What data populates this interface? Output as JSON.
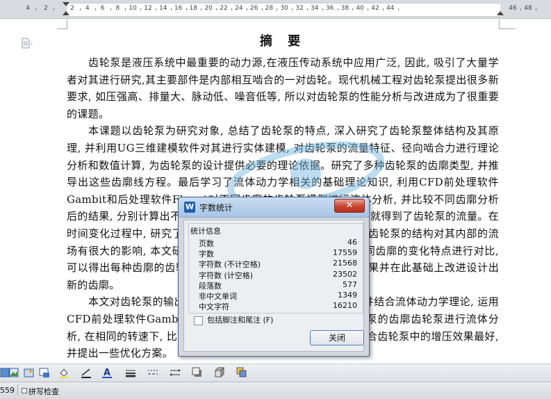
{
  "ruler": {
    "numbers": [
      "4",
      "2",
      "2",
      "4",
      "6",
      "8",
      "10",
      "12",
      "14",
      "16",
      "18",
      "20",
      "22",
      "24",
      "26",
      "28",
      "30",
      "32",
      "34",
      "36",
      "38",
      "40",
      "42",
      "44",
      "46",
      "48"
    ]
  },
  "document": {
    "title": "摘 要",
    "paragraphs": [
      "齿轮泵是液压系统中最重要的动力源,在液压传动系统中应用广泛, 因此, 吸引了大量学者对其进行研究,其主要部件是内部相互啮合的一对齿轮。现代机械工程对齿轮泵提出很多新要求, 如压强高、排量大、脉动低、噪音低等, 所以对齿轮泵的性能分析与改进成为了很重要的课题。",
      "本课题以齿轮泵为研究对象, 总结了齿轮泵的特点, 深入研究了齿轮泵整体结构及其原理, 并利用UG三维建模软件对其进行实体建模, 对齿轮泵的流量特征、径向啮合力进行理论分析和数值计算, 为齿轮泵的设计提供必要的理论依据。研究了多种齿轮泵的齿廓类型, 并推导出这些齿廓线方程。最后学习了流体动力学相关的基础理论知识, 利用CFD前处理软件Gambit和后处理软件Fluent对不同齿廓的齿轮泵模型进行流体分析, 并比较不同齿廓分析后的结果, 分别计算出不同齿廓的齿轮泵在出口区域的流量, 最后就得到了齿轮泵的流量。在时间变化过程中, 研究了其流场中压力与速度变化情况。外啮合齿轮泵的结构对其内部的流场有很大的影响, 本文研究了多种不同齿廓的齿轮泵模型, 就不同齿廓的变化特点进行对比, 可以得出每种齿廓的齿轮泵的流场分布情况, 选出最优的分析结果并在此基础上改进设计出新的齿廓。",
      "本文对齿轮泵的输出流量进行了分析与研究, 通过理论分析并结合流体动力学理论, 运用CFD前处理软件Gambit和后处理软件Fluent对不同齿廓齿轮泵的齿廓齿轮泵进行流体分析, 在相同的转速下, 比较不同齿廓的输出流量, 可以得出在外啮合齿轮泵中的增压效果最好, 并提出一些优化方案。"
    ]
  },
  "watermark": {
    "text": "renrendoc.com"
  },
  "dialog": {
    "title": "字数统计",
    "group_label": "统计信息",
    "stats": [
      {
        "label": "页数",
        "value": "46"
      },
      {
        "label": "字数",
        "value": "17559"
      },
      {
        "label": "字符数 (不计空格)",
        "value": "21568"
      },
      {
        "label": "字符数 (计空格)",
        "value": "23502"
      },
      {
        "label": "段落数",
        "value": "577"
      },
      {
        "label": "非中文单词",
        "value": "1349"
      },
      {
        "label": "中文字符",
        "value": "16210"
      }
    ],
    "checkbox_label": "包括脚注和尾注 (F)",
    "checkbox_checked": false,
    "close_label": "关闭",
    "app_icon_letter": "W"
  },
  "statusbar": {
    "word_count_fragment": "559",
    "spellcheck_label": "拼写检查"
  },
  "colors": {
    "title_bar": "#a9c4e6",
    "close_button": "#c7442f",
    "accent_blue": "#1f5fae"
  }
}
